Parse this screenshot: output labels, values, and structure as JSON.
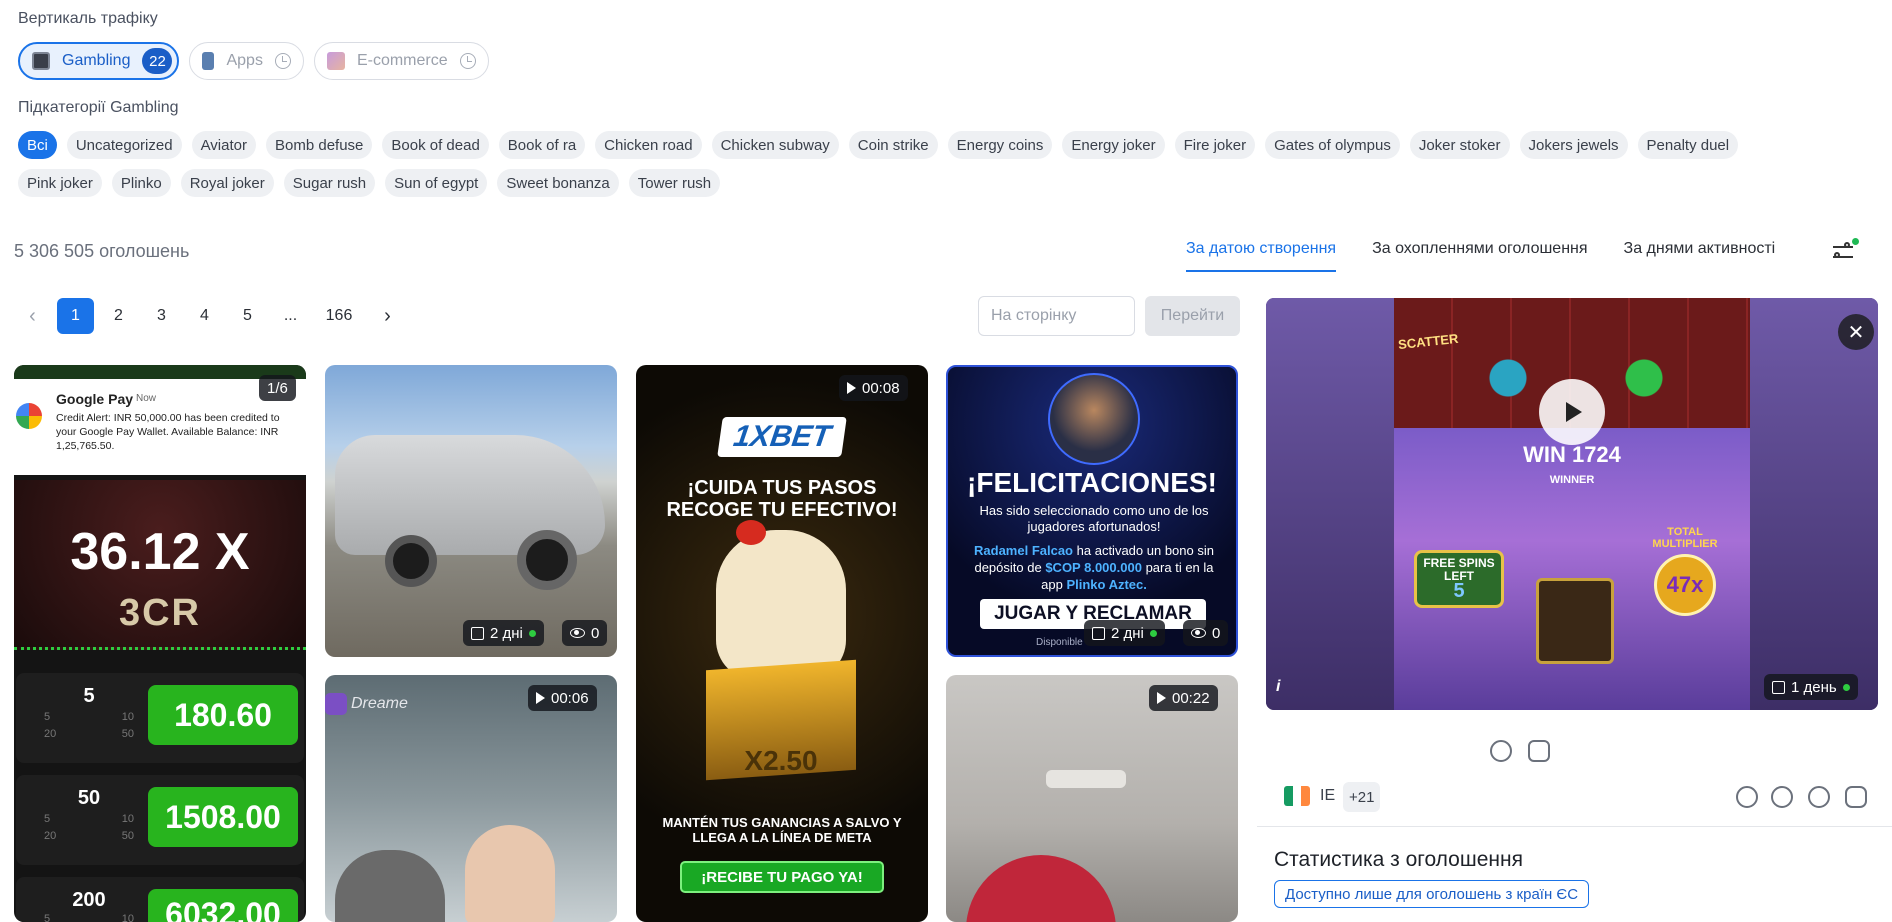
{
  "verticals": {
    "label": "Вертикаль трафіку",
    "items": [
      {
        "label": "Gambling",
        "count": "22",
        "active": true
      },
      {
        "label": "Apps",
        "active": false
      },
      {
        "label": "E-commerce",
        "active": false
      }
    ]
  },
  "subcategories": {
    "label": "Підкатегорії Gambling",
    "row1": [
      "Всі",
      "Uncategorized",
      "Aviator",
      "Bomb defuse",
      "Book of dead",
      "Book of ra",
      "Chicken road",
      "Chicken subway",
      "Coin strike",
      "Energy coins",
      "Energy joker",
      "Fire joker",
      "Gates of olympus",
      "Joker stoker",
      "Jokers jewels",
      "Penalty duel"
    ],
    "row2": [
      "Pink joker",
      "Plinko",
      "Royal joker",
      "Sugar rush",
      "Sun of egypt",
      "Sweet bonanza",
      "Tower rush"
    ]
  },
  "results": {
    "count_text": "5 306 505 оголошень"
  },
  "sort": {
    "tabs": [
      "За датою створення",
      "За охопленнями оголошення",
      "За днями активності"
    ],
    "active_index": 0
  },
  "pagination": {
    "pages": [
      "1",
      "2",
      "3",
      "4",
      "5",
      "...",
      "166"
    ],
    "current": "1",
    "goto_placeholder": "На сторінку",
    "goto_button": "Перейти"
  },
  "cards": [
    {
      "counter": "1/6",
      "notification_app": "Google Pay",
      "notification_time": "Now",
      "notification_text": "Credit Alert: INR 50,000.00 has been credited to your Google Pay Wallet. Available Balance: INR 1,25,765.50.",
      "multiplier": "36.12 X",
      "brand": "3CR",
      "rows": [
        {
          "bet": "5",
          "opts": [
            "5",
            "10",
            "20",
            "50"
          ],
          "win": "180.60"
        },
        {
          "bet": "50",
          "opts": [
            "5",
            "10",
            "20",
            "50"
          ],
          "win": "1508.00"
        },
        {
          "bet": "200",
          "opts": [
            "5",
            "10"
          ],
          "win": "6032.00"
        }
      ]
    },
    {
      "days": "2 дні",
      "views": "0"
    },
    {
      "duration": "00:06",
      "brand": "Dreame"
    },
    {
      "duration": "00:08",
      "brand": "1XBET",
      "headline": "¡CUIDA TUS PASOS RECOGE TU EFECTIVO!",
      "multiplier": "X2.50",
      "footer": "MANTÉN TUS GANANCIAS A SALVO Y LLEGA A LA LÍNEA DE META",
      "cta": "¡RECIBE TU PAGO YA!"
    },
    {
      "headline": "¡FELICITACIONES!",
      "line1": "Has sido seleccionado como uno de los jugadores afortunados!",
      "name": "Radamel Falcao",
      "mid": "ha activado un bono sin depósito de",
      "amount": "$COP 8.000.000",
      "tail": "para ti en la app",
      "app": "Plinko Aztec.",
      "cta": "JUGAR Y RECLAMAR",
      "small": "Disponible",
      "days": "2 дні",
      "views": "0"
    },
    {
      "duration": "00:22"
    }
  ],
  "detail": {
    "win_text": "WIN 1724",
    "winner": "WINNER",
    "free_spins": "FREE SPINS LEFT",
    "free_spins_count": "5",
    "total_multiplier": "TOTAL MULTIPLIER",
    "multiplier": "47x",
    "scatter": "SCATTER",
    "days": "1 день",
    "country": "IE",
    "more_countries": "+21",
    "stats_title": "Статистика з оголошення",
    "eu_note": "Доступно лише для оголошень з країн ЄС"
  },
  "colors": {
    "accent": "#1a73e8",
    "active_dot": "#2ecc40"
  }
}
